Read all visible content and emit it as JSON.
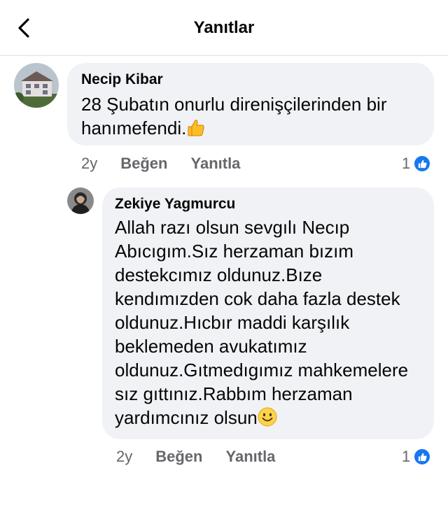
{
  "header": {
    "title": "Yanıtlar"
  },
  "comments": [
    {
      "author": "Necip Kibar",
      "text": "28 Şubatın onurlu direnişçilerinden bir\nhanımefendi.",
      "emoji": "thumbs-up",
      "time": "2y",
      "like_label": "Beğen",
      "reply_label": "Yanıtla",
      "reaction_count": "1",
      "reaction_icon": "like-icon"
    },
    {
      "author": "Zekiye Yagmurcu",
      "text": "Allah razı olsun sevgılı Necıp\nAbıcıgım.Sız herzaman bızım\ndestekcımız oldunuz.Bıze\nkendımızden cok daha fazla destek\noldunuz.Hıcbır maddi karşılık\nbeklemeden avukatımız\noldunuz.Gıtmedıgımız mahkemelere\nsız gıttınız.Rabbım herzaman\nyardımcınız olsun",
      "emoji": "smiling-face",
      "time": "2y",
      "like_label": "Beğen",
      "reply_label": "Yanıtla",
      "reaction_count": "1",
      "reaction_icon": "like-icon"
    }
  ],
  "colors": {
    "bubble": "#f0f2f5",
    "like_blue": "#1877f2",
    "meta_gray": "#65676b"
  }
}
